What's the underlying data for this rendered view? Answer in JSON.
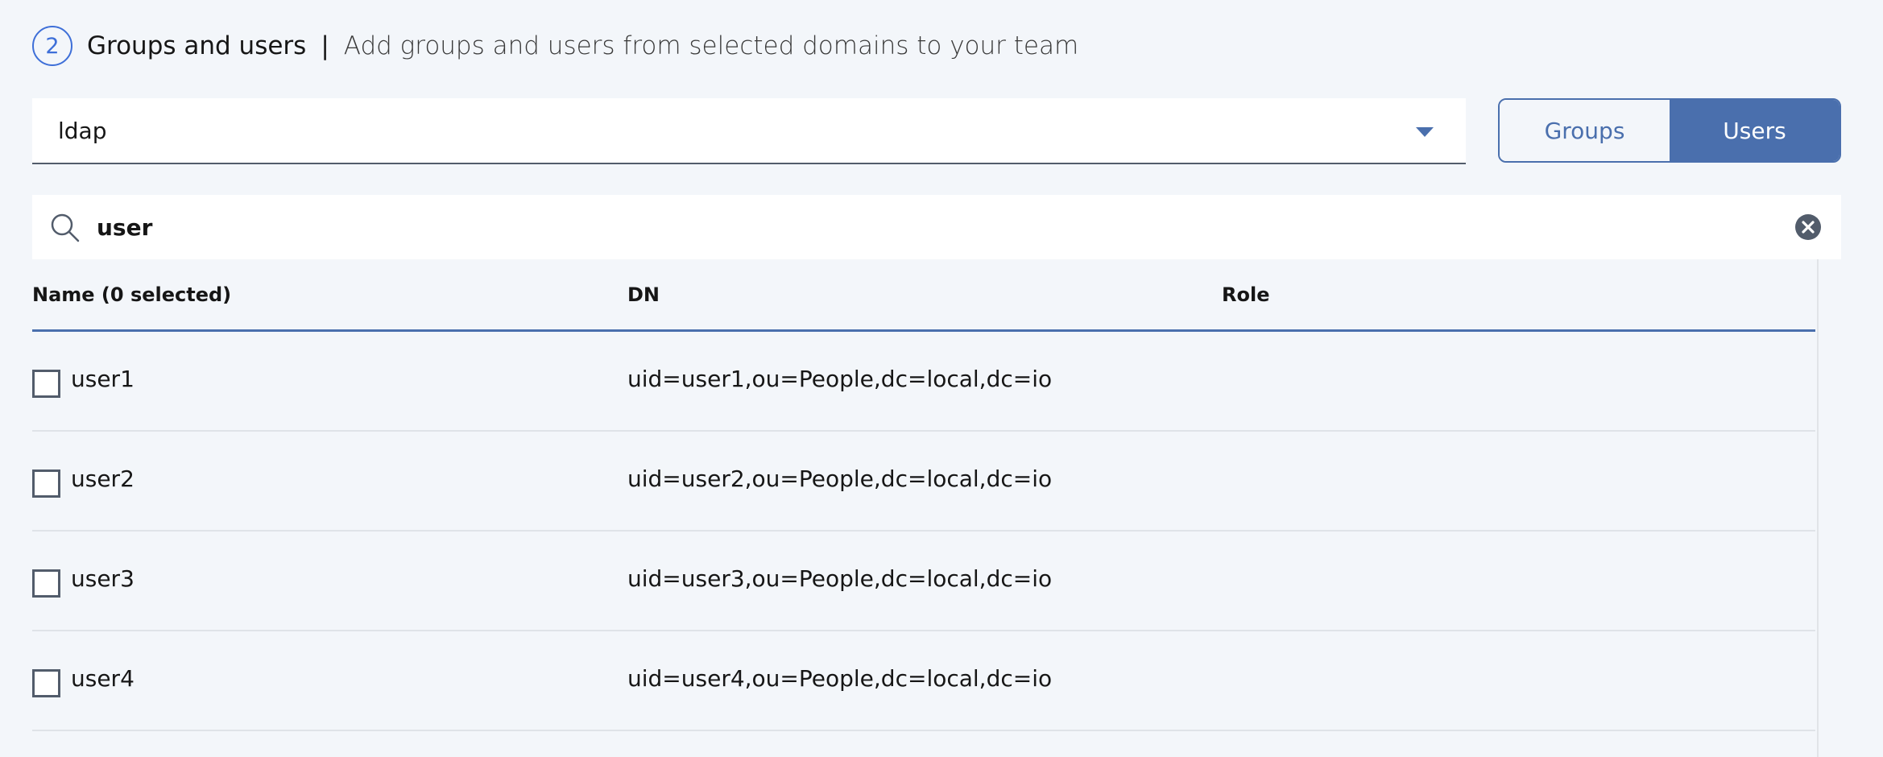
{
  "step": {
    "number": "2",
    "title": "Groups and users",
    "separator": "|",
    "description": "Add groups and users from selected domains to your team"
  },
  "domain_select": {
    "selected": "ldap"
  },
  "view_toggle": {
    "groups_label": "Groups",
    "users_label": "Users",
    "active": "Users"
  },
  "search": {
    "value": "user"
  },
  "table": {
    "columns": [
      "Name (0 selected)",
      "DN",
      "Role"
    ],
    "rows": [
      {
        "name": "user1",
        "dn": "uid=user1,ou=People,dc=local,dc=io",
        "role": ""
      },
      {
        "name": "user2",
        "dn": "uid=user2,ou=People,dc=local,dc=io",
        "role": ""
      },
      {
        "name": "user3",
        "dn": "uid=user3,ou=People,dc=local,dc=io",
        "role": ""
      },
      {
        "name": "user4",
        "dn": "uid=user4,ou=People,dc=local,dc=io",
        "role": ""
      }
    ]
  },
  "colors": {
    "accent": "#4a6fad",
    "step_blue": "#3e6fd8",
    "background": "#f3f6fa"
  },
  "icons": {
    "search": "search-icon",
    "clear": "close-filled-icon",
    "dropdown": "caret-down-icon",
    "checkbox": "checkbox-unchecked"
  }
}
